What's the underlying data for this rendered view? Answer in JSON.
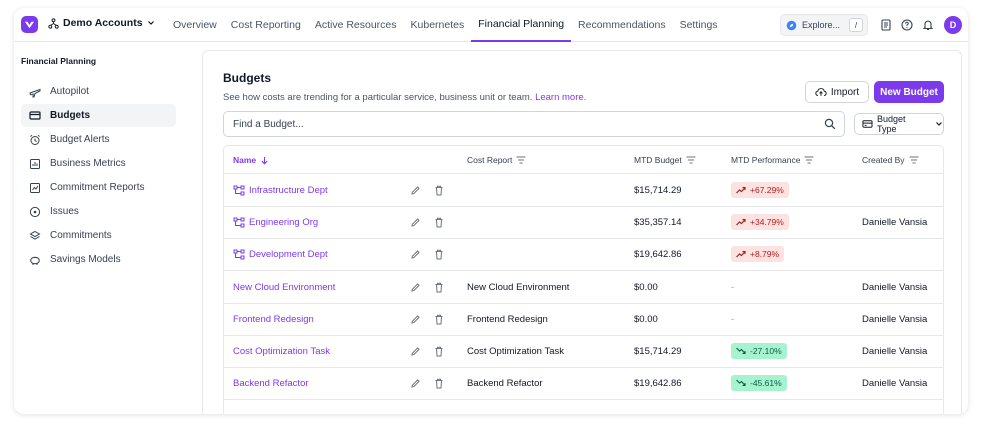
{
  "topbar": {
    "account": "Demo Accounts",
    "nav": [
      "Overview",
      "Cost Reporting",
      "Active Resources",
      "Kubernetes",
      "Financial Planning",
      "Recommendations",
      "Settings"
    ],
    "active_nav": "Financial Planning",
    "explore_label": "Explore...",
    "explore_shortcut": "/",
    "avatar_initial": "D"
  },
  "sidebar": {
    "title": "Financial Planning",
    "items": [
      {
        "label": "Autopilot",
        "icon": "plane-icon"
      },
      {
        "label": "Budgets",
        "icon": "wallet-icon",
        "active": true
      },
      {
        "label": "Budget Alerts",
        "icon": "alarm-icon"
      },
      {
        "label": "Business Metrics",
        "icon": "metrics-icon"
      },
      {
        "label": "Commitment Reports",
        "icon": "report-icon"
      },
      {
        "label": "Issues",
        "icon": "issue-icon"
      },
      {
        "label": "Commitments",
        "icon": "layers-icon"
      },
      {
        "label": "Savings Models",
        "icon": "piggy-bank-icon"
      }
    ]
  },
  "budgets": {
    "title": "Budgets",
    "subtitle": "See how costs are trending for a particular service, business unit or team.",
    "learn_more": "Learn more.",
    "import_label": "Import",
    "new_label": "New Budget",
    "search_placeholder": "Find a Budget...",
    "type_label": "Budget Type"
  },
  "table": {
    "columns": {
      "name": "Name",
      "cost_report": "Cost Report",
      "mtd_budget": "MTD Budget",
      "mtd_performance": "MTD Performance",
      "created_by": "Created By"
    },
    "rows": [
      {
        "name": "Infrastructure Dept",
        "hierarchy": true,
        "cost_report": "",
        "mtd_budget": "$15,714.29",
        "perf": "+67.29%",
        "trend": "up",
        "created_by": ""
      },
      {
        "name": "Engineering Org",
        "hierarchy": true,
        "cost_report": "",
        "mtd_budget": "$35,357.14",
        "perf": "+34.79%",
        "trend": "up",
        "created_by": "Danielle Vansia"
      },
      {
        "name": "Development Dept",
        "hierarchy": true,
        "cost_report": "",
        "mtd_budget": "$19,642.86",
        "perf": "+8.79%",
        "trend": "up",
        "created_by": ""
      },
      {
        "name": "New Cloud Environment",
        "hierarchy": false,
        "cost_report": "New Cloud Environment",
        "mtd_budget": "$0.00",
        "perf": "-",
        "trend": "none",
        "created_by": "Danielle Vansia"
      },
      {
        "name": "Frontend Redesign",
        "hierarchy": false,
        "cost_report": "Frontend Redesign",
        "mtd_budget": "$0.00",
        "perf": "-",
        "trend": "none",
        "created_by": "Danielle Vansia"
      },
      {
        "name": "Cost Optimization Task",
        "hierarchy": false,
        "cost_report": "Cost Optimization Task",
        "mtd_budget": "$15,714.29",
        "perf": "-27.10%",
        "trend": "down",
        "created_by": "Danielle Vansia"
      },
      {
        "name": "Backend Refactor",
        "hierarchy": false,
        "cost_report": "Backend Refactor",
        "mtd_budget": "$19,642.86",
        "perf": "-45.61%",
        "trend": "down",
        "created_by": "Danielle Vansia"
      }
    ]
  },
  "colors": {
    "accent": "#7c3aed",
    "up_bg": "#fde2e2",
    "down_bg": "#a7f3d0"
  }
}
